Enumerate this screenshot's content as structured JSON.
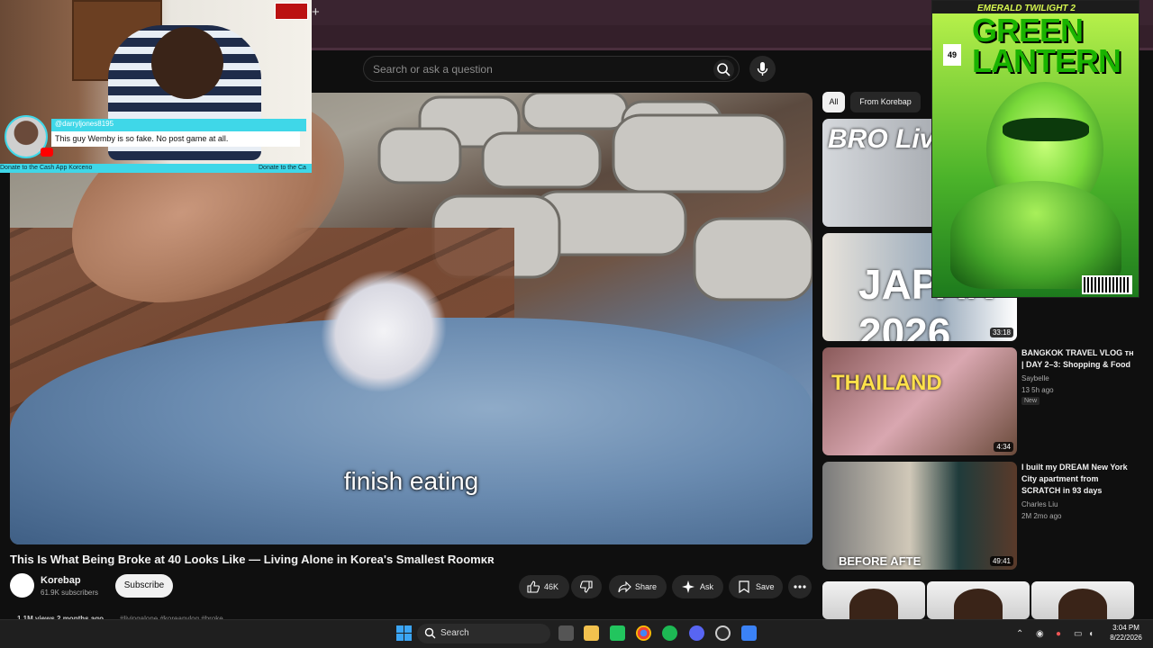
{
  "browser": {
    "new_tab_symbol": "+"
  },
  "search": {
    "placeholder": "Search or ask a question"
  },
  "video": {
    "subtitle": "finish eating"
  },
  "webcam": {
    "chat_username": "@darryljones8195",
    "chat_message": "This guy Wemby is so fake. No post game at all.",
    "donate_left": "Donate to the Cash App Korceno",
    "donate_right": "Donate to the Ca"
  },
  "meta": {
    "title": "This Is What Being Broke at 40 Looks Like — Living Alone in Korea's Smallest Roomᴋʀ",
    "channel": "Korebap",
    "subscribers": "61.9K subscribers",
    "subscribe_label": "Subscribe",
    "likes": "46K",
    "share_label": "Share",
    "ask_label": "Ask",
    "save_label": "Save",
    "views": "1.1M views  2 months ago",
    "tags": "#livingalone #koreanvlog #broke"
  },
  "sidebar": {
    "chips": [
      "All",
      "From Korebap"
    ],
    "items": [
      {
        "thumb_text": "BRO Living",
        "duration": "",
        "title": "",
        "channel": "",
        "meta": ""
      },
      {
        "thumb_text": "JAPAN 2026",
        "duration": "33:18",
        "title": "",
        "channel": "",
        "meta": ""
      },
      {
        "thumb_text": "THAILAND",
        "duration": "4:34",
        "title": "BANGKOK TRAVEL VLOG ᴛʜ | DAY 2–3: Shopping & Food",
        "channel": "Saybelle",
        "meta": "13  5h ago",
        "badge": "New"
      },
      {
        "thumb_text": "BEFORE      AFTE",
        "duration": "49:41",
        "title": "I built my DREAM New York City apartment from SCRATCH in 93 days",
        "channel": "Charles Liu",
        "meta": "2M  2mo ago"
      }
    ]
  },
  "comic": {
    "top_line": "EMERALD TWILIGHT 2",
    "logo": "GREEN LANTERN",
    "issue": "49"
  },
  "taskbar": {
    "search_label": "Search",
    "time": "3:04 PM",
    "date": "8/22/2026"
  },
  "colors": {
    "accent": "#3fd7e8",
    "yt_red": "#ff0000",
    "comic_green": "#19b300"
  }
}
